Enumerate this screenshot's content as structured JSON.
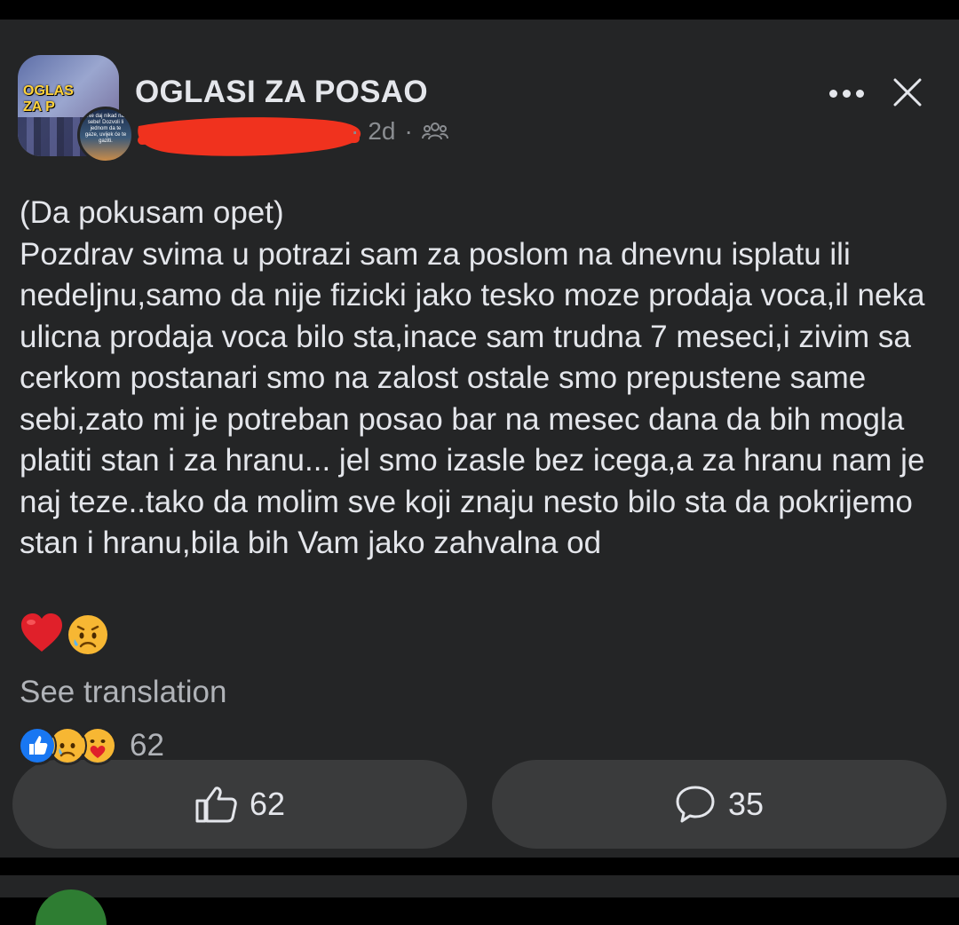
{
  "post": {
    "group_name": "OGLASI ZA POSAO",
    "group_avatar_text": [
      "OGLAS",
      "ZA P"
    ],
    "user_avatar_text": "Ne daj nikad na sebe! Dozvoli li jednom da te gaze, uvijek će te gaziti.",
    "time": "2d",
    "separator": "·",
    "privacy_icon": "group-members-icon",
    "more_icon": "more-horizontal-icon",
    "close_icon": "close-icon",
    "body": "(Da pokusam opet)\nPozdrav svima u potrazi sam za poslom na dnevnu isplatu ili nedeljnu,samo da nije fizicki jako tesko moze prodaja voca,il neka ulicna prodaja voca bilo sta,inace sam trudna 7 meseci,i zivim sa cerkom postanari smo na zalost ostale smo prepustene same sebi,zato mi je potreban posao bar na mesec dana da bih mogla platiti stan i za hranu... jel smo izasle bez icega,a za hranu nam je naj teze..tako da molim sve koji znaju nesto bilo sta da pokrijemo stan i hranu,bila bih Vam jako zahvalna od",
    "trailing_emojis": [
      "red-heart",
      "sad-but-relieved-face"
    ],
    "see_translation": "See translation",
    "reaction_icons": [
      "like-reaction-icon",
      "sad-reaction-icon",
      "care-reaction-icon"
    ],
    "reaction_count": "62"
  },
  "actions": {
    "like_count": "62",
    "comment_count": "35"
  },
  "colors": {
    "background": "#242526",
    "text": "#e4e6eb",
    "muted": "#b0b3b8",
    "button": "#3a3b3c",
    "redaction": "#f0321e",
    "like_blue": "#1877f2"
  }
}
